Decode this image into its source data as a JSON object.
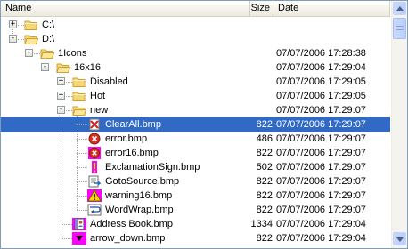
{
  "columns": {
    "name": "Name",
    "size": "Size",
    "date": "Date"
  },
  "rows": [
    {
      "label": "C:\\",
      "size": "",
      "date": "",
      "icon": "folder-icon",
      "expander": "+"
    },
    {
      "label": "D:\\",
      "size": "",
      "date": "",
      "icon": "folder-icon",
      "expander": "-"
    },
    {
      "label": "1Icons",
      "size": "",
      "date": "07/07/2006 17:28:38",
      "icon": "folder-icon",
      "expander": "-"
    },
    {
      "label": "16x16",
      "size": "",
      "date": "07/07/2006 17:29:04",
      "icon": "folder-icon",
      "expander": "-"
    },
    {
      "label": "Disabled",
      "size": "",
      "date": "07/07/2006 17:29:05",
      "icon": "folder-icon",
      "expander": "+"
    },
    {
      "label": "Hot",
      "size": "",
      "date": "07/07/2006 17:29:05",
      "icon": "folder-icon",
      "expander": "+"
    },
    {
      "label": "new",
      "size": "",
      "date": "07/07/2006 17:29:07",
      "icon": "folder-icon",
      "expander": "-"
    },
    {
      "label": "ClearAll.bmp",
      "size": "822",
      "date": "07/07/2006 17:29:07",
      "icon": "clear-all-icon",
      "expander": "",
      "selected": true
    },
    {
      "label": "error.bmp",
      "size": "486",
      "date": "07/07/2006 17:29:07",
      "icon": "error-icon",
      "expander": ""
    },
    {
      "label": "error16.bmp",
      "size": "822",
      "date": "07/07/2006 17:29:07",
      "icon": "error16-icon",
      "expander": ""
    },
    {
      "label": "ExclamationSign.bmp",
      "size": "502",
      "date": "07/07/2006 17:29:07",
      "icon": "exclamation-sign-icon",
      "expander": ""
    },
    {
      "label": "GotoSource.bmp",
      "size": "822",
      "date": "07/07/2006 17:29:07",
      "icon": "goto-source-icon",
      "expander": ""
    },
    {
      "label": "warning16.bmp",
      "size": "822",
      "date": "07/07/2006 17:29:07",
      "icon": "warning-icon",
      "expander": ""
    },
    {
      "label": "WordWrap.bmp",
      "size": "822",
      "date": "07/07/2006 17:29:07",
      "icon": "word-wrap-icon",
      "expander": ""
    },
    {
      "label": "Address Book.bmp",
      "size": "1334",
      "date": "07/07/2006 17:29:04",
      "icon": "address-book-icon",
      "expander": ""
    },
    {
      "label": "arrow_down.bmp",
      "size": "822",
      "date": "07/07/2006 17:29:04",
      "icon": "arrow-down-icon",
      "expander": ""
    }
  ],
  "colors": {
    "selection": "#316ac5",
    "folder": "#f7d774",
    "magenta": "#ff00ff"
  }
}
